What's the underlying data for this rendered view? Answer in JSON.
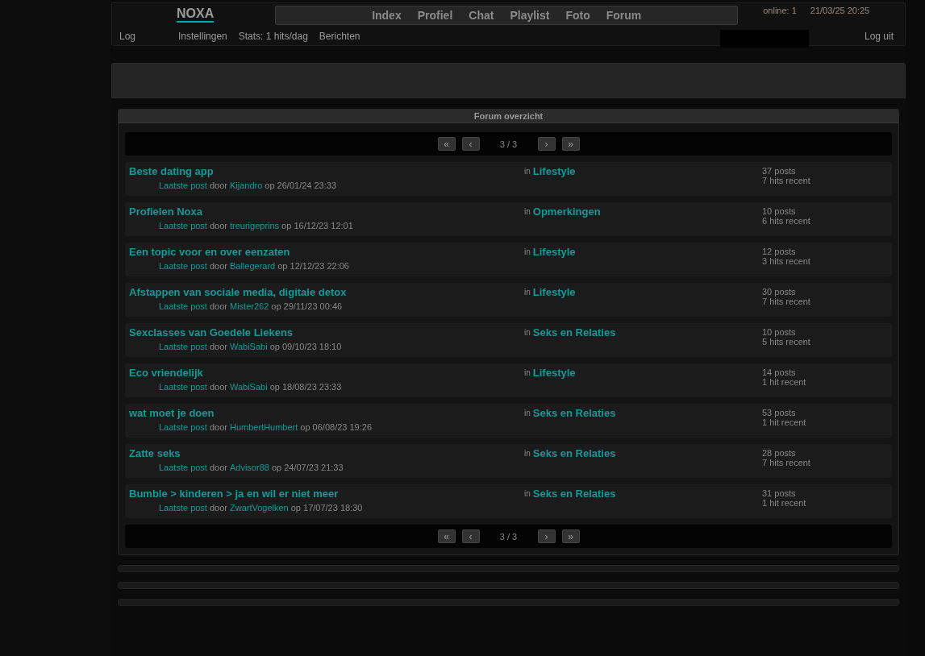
{
  "site": {
    "logo": "NOXA",
    "nav": [
      "Index",
      "Profiel",
      "Chat",
      "Playlist",
      "Foto",
      "Forum"
    ],
    "online": "online: 1",
    "datetime": "21/03/25 20:25",
    "sub_nav_left": "Log",
    "sub_nav": [
      "Instellingen",
      "Stats: 1 hits/dag",
      "Berichten"
    ],
    "logout": "Log uit"
  },
  "forum": {
    "title": "Forum overzicht",
    "pagers": [
      {
        "first": "«",
        "prev": "‹",
        "page": "3 / 3",
        "next": "›",
        "last": "»"
      },
      {
        "first": "«",
        "prev": "‹",
        "page": "3 / 3",
        "next": "›",
        "last": "»"
      }
    ],
    "topics": [
      {
        "title": "Beste dating app",
        "last_post": "Laatste post",
        "by": "door",
        "author": "Kijandro",
        "date": "op 26/01/24 23:33",
        "in": "in",
        "category": "Lifestyle",
        "posts": "37 posts",
        "hits": "7 hits recent"
      },
      {
        "title": "Profielen Noxa",
        "last_post": "Laatste post",
        "by": "door",
        "author": "treurigeprins",
        "date": "op 16/12/23 12:01",
        "in": "in",
        "category": "Opmerkingen",
        "posts": "10 posts",
        "hits": "6 hits recent"
      },
      {
        "title": "Een topic voor en over eenzaten",
        "last_post": "Laatste post",
        "by": "door",
        "author": "Ballegerard",
        "date": "op 12/12/23 22:06",
        "in": "in",
        "category": "Lifestyle",
        "posts": "12 posts",
        "hits": "3 hits recent"
      },
      {
        "title": "Afstappen van sociale media, digitale detox",
        "last_post": "Laatste post",
        "by": "door",
        "author": "Mister262",
        "date": "op 29/11/23 00:46",
        "in": "in",
        "category": "Lifestyle",
        "posts": "30 posts",
        "hits": "7 hits recent"
      },
      {
        "title": "Sexclasses van Goedele Liekens",
        "last_post": "Laatste post",
        "by": "door",
        "author": "WabiSabi",
        "date": "op 09/10/23 18:10",
        "in": "in",
        "category": "Seks en Relaties",
        "posts": "10 posts",
        "hits": "5 hits recent"
      },
      {
        "title": "Eco vriendelijk",
        "last_post": "Laatste post",
        "by": "door",
        "author": "WabiSabi",
        "date": "op 18/08/23 23:33",
        "in": "in",
        "category": "Lifestyle",
        "posts": "14 posts",
        "hits": "1 hit recent"
      },
      {
        "title": "wat moet je doen",
        "last_post": "Laatste post",
        "by": "door",
        "author": "HumbertHumbert",
        "date": "op 06/08/23 19:26",
        "in": "in",
        "category": "Seks en Relaties",
        "posts": "53 posts",
        "hits": "1 hit recent"
      },
      {
        "title": "Zatte seks",
        "last_post": "Laatste post",
        "by": "door",
        "author": "Advisor88",
        "date": "op 24/07/23 21:33",
        "in": "in",
        "category": "Seks en Relaties",
        "posts": "28 posts",
        "hits": "7 hits recent"
      },
      {
        "title": "Bumble > kinderen > ja en wil er niet meer",
        "last_post": "Laatste post",
        "by": "door",
        "author": "ZwartVogelken",
        "date": "op 17/07/23 18:30",
        "in": "in",
        "category": "Seks en Relaties",
        "posts": "31 posts",
        "hits": "1 hit recent"
      }
    ]
  }
}
